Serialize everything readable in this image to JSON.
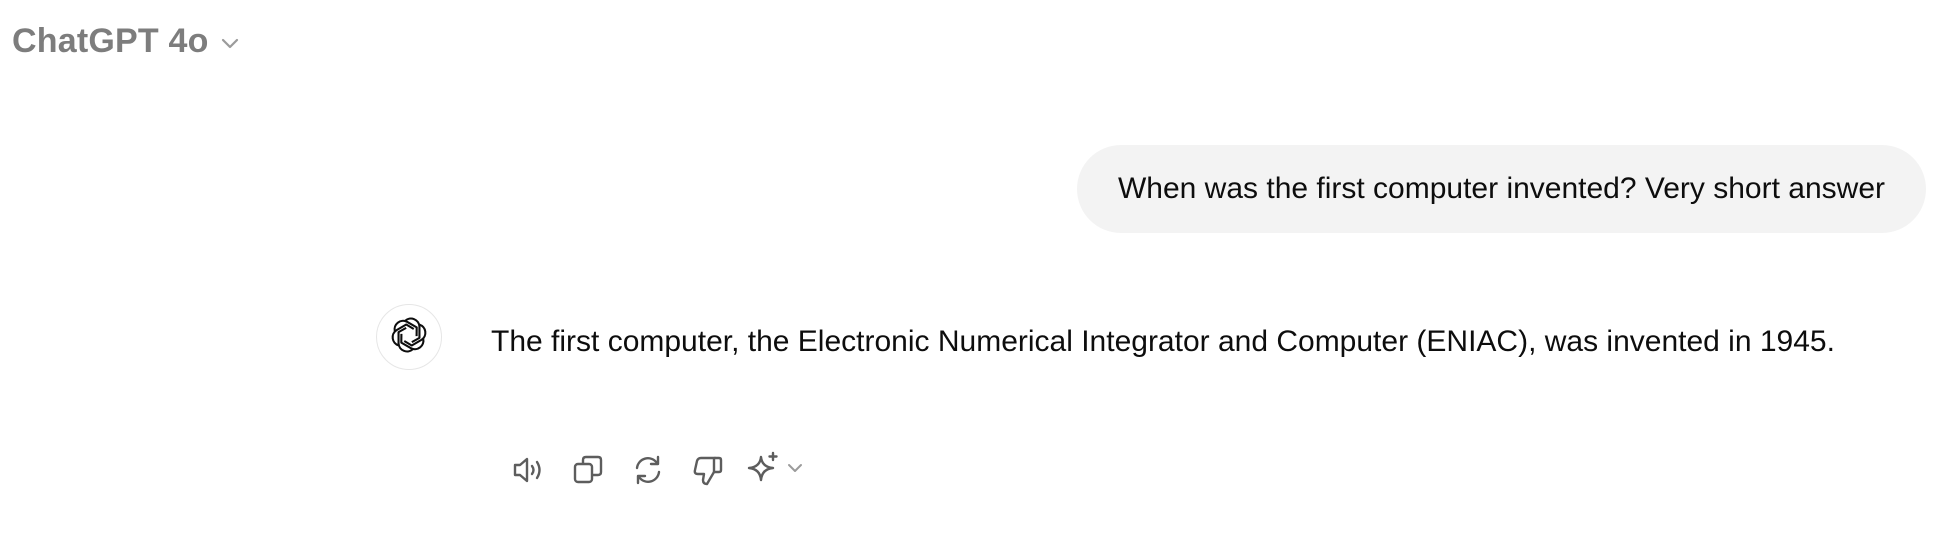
{
  "header": {
    "model_label": "ChatGPT 4o",
    "chevron_icon": "chevron-down-icon"
  },
  "conversation": {
    "user_message": "When was the first computer invented? Very short answer",
    "assistant_avatar_icon": "openai-logo-icon",
    "assistant_message": "The first computer, the Electronic Numerical Integrator and Computer (ENIAC), was invented in 1945."
  },
  "actions": {
    "items": [
      {
        "icon": "read-aloud-icon"
      },
      {
        "icon": "copy-icon"
      },
      {
        "icon": "regenerate-icon"
      },
      {
        "icon": "thumbs-down-icon"
      },
      {
        "icon": "sparkle-icon"
      }
    ]
  },
  "colors": {
    "model_label": "#7d7d7d",
    "bubble_background": "#f3f3f3",
    "text": "#0d0d0d",
    "icon": "#5d5d5d"
  }
}
